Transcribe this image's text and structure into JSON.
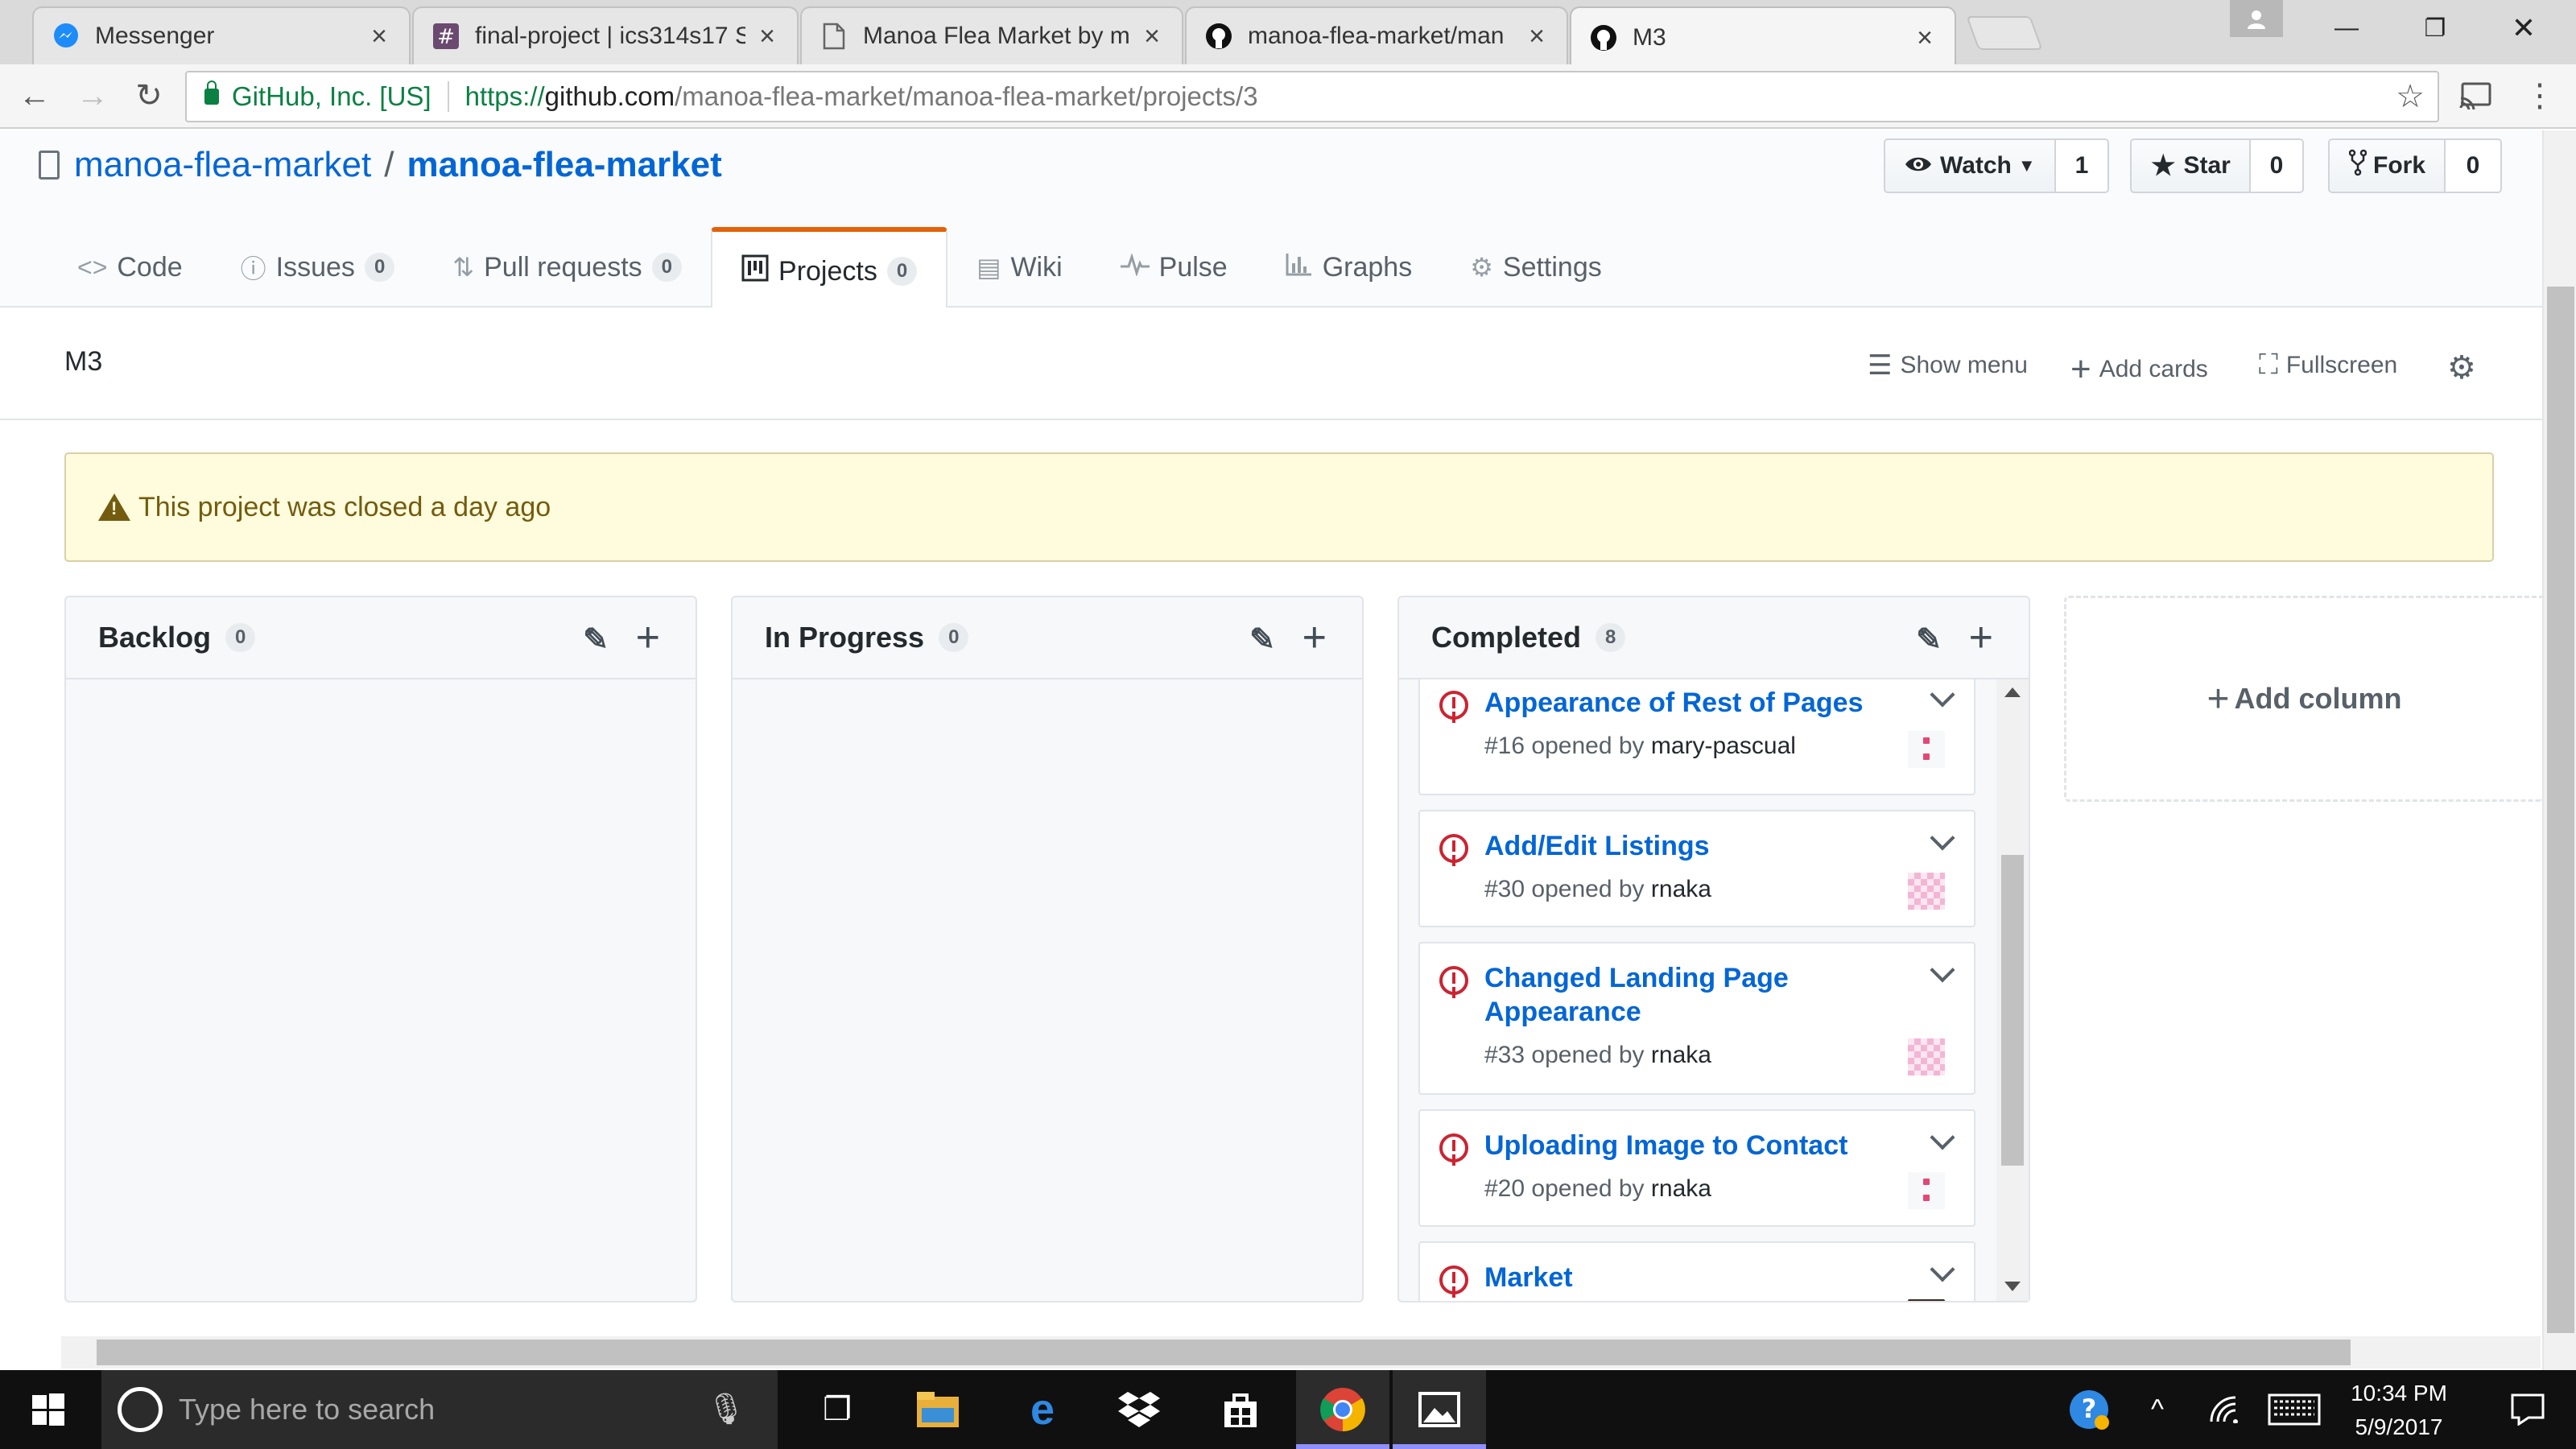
{
  "browser": {
    "tabs": [
      {
        "label": "Messenger",
        "icon": "messenger-icon"
      },
      {
        "label": "final-project | ics314s17 S",
        "icon": "slack-hash-icon"
      },
      {
        "label": "Manoa Flea Market by m",
        "icon": "document-icon"
      },
      {
        "label": "manoa-flea-market/man",
        "icon": "github-icon"
      },
      {
        "label": "M3",
        "icon": "github-icon"
      }
    ],
    "secure_label": "GitHub, Inc. [US]",
    "url_scheme": "https://",
    "url_host": "github.com",
    "url_path": "/manoa-flea-market/manoa-flea-market/projects/3"
  },
  "repo": {
    "owner": "manoa-flea-market",
    "separator": "/",
    "name": "manoa-flea-market",
    "watch_label": "Watch",
    "watch_count": "1",
    "star_label": "Star",
    "star_count": "0",
    "fork_label": "Fork",
    "fork_count": "0"
  },
  "nav": {
    "code": "Code",
    "issues": "Issues",
    "issues_count": "0",
    "pulls": "Pull requests",
    "pulls_count": "0",
    "projects": "Projects",
    "projects_count": "0",
    "wiki": "Wiki",
    "pulse": "Pulse",
    "graphs": "Graphs",
    "settings": "Settings"
  },
  "project": {
    "name": "M3",
    "show_menu": "Show menu",
    "add_cards": "Add cards",
    "fullscreen": "Fullscreen",
    "closed_notice": "This project was closed a day ago",
    "add_column": "Add column"
  },
  "columns": [
    {
      "name": "Backlog",
      "count": "0"
    },
    {
      "name": "In Progress",
      "count": "0"
    },
    {
      "name": "Completed",
      "count": "8"
    }
  ],
  "cards": [
    {
      "title": "Appearance of Rest of Pages",
      "number": "#16",
      "opened_by": "opened by",
      "user": "mary-pascual"
    },
    {
      "title": "Add/Edit Listings",
      "number": "#30",
      "opened_by": "opened by",
      "user": "rnaka"
    },
    {
      "title": "Changed Landing Page Appearance",
      "number": "#33",
      "opened_by": "opened by",
      "user": "rnaka"
    },
    {
      "title": "Uploading Image to Contact",
      "number": "#20",
      "opened_by": "opened by",
      "user": "rnaka"
    },
    {
      "title": "Market",
      "number": "",
      "opened_by": "",
      "user": ""
    }
  ],
  "taskbar": {
    "search_placeholder": "Type here to search",
    "time": "10:34 PM",
    "date": "5/9/2017"
  },
  "colors": {
    "accent_link": "#0366d6",
    "selected_tab_border": "#e36209",
    "issue_closed_red": "#cb2431",
    "flash_bg": "#fffbdd"
  }
}
